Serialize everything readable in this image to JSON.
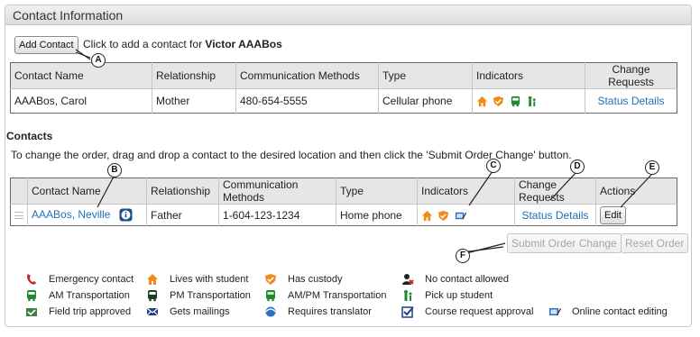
{
  "panel": {
    "title": "Contact Information"
  },
  "top": {
    "add_button": "Add Contact",
    "hint_prefix": "Click to add a contact for",
    "student_name": "Victor AAABos"
  },
  "primary_table": {
    "headers": [
      "Contact Name",
      "Relationship",
      "Communication Methods",
      "Type",
      "Indicators",
      "Change Requests"
    ],
    "row": {
      "name": "AAABos, Carol",
      "relationship": "Mother",
      "phone": "480-654-5555",
      "type": "Cellular phone",
      "indicators": [
        "lives-with-student-icon",
        "has-custody-icon",
        "am-pm-transportation-icon",
        "pick-up-student-icon"
      ],
      "change_link": "Status Details"
    }
  },
  "contacts": {
    "title": "Contacts",
    "instructions": "To change the order, drag and drop a contact to the desired location and then click the 'Submit Order Change' button.",
    "headers": [
      "Contact Name",
      "Relationship",
      "Communication Methods",
      "Type",
      "Indicators",
      "Change Requests",
      "Actions"
    ],
    "row": {
      "name": "AAABos, Neville",
      "relationship": "Father",
      "phone": "1-604-123-1234",
      "type": "Home phone",
      "indicators": [
        "lives-with-student-icon",
        "has-custody-icon",
        "online-contact-editing-icon"
      ],
      "change_link": "Status Details",
      "action": "Edit"
    },
    "submit_button": "Submit Order Change",
    "reset_button": "Reset Order"
  },
  "callouts": [
    "A",
    "B",
    "C",
    "D",
    "E",
    "F"
  ],
  "legend": [
    {
      "icon": "emergency-contact-icon",
      "label": "Emergency contact"
    },
    {
      "icon": "lives-with-student-icon",
      "label": "Lives with student"
    },
    {
      "icon": "has-custody-icon",
      "label": "Has custody"
    },
    {
      "icon": "no-contact-allowed-icon",
      "label": "No contact allowed"
    },
    {
      "icon": "am-transportation-icon",
      "label": "AM Transportation"
    },
    {
      "icon": "pm-transportation-icon",
      "label": "PM Transportation"
    },
    {
      "icon": "am-pm-transportation-icon",
      "label": "AM/PM Transportation"
    },
    {
      "icon": "pick-up-student-icon",
      "label": "Pick up student"
    },
    {
      "icon": "field-trip-approved-icon",
      "label": "Field trip approved"
    },
    {
      "icon": "gets-mailings-icon",
      "label": "Gets mailings"
    },
    {
      "icon": "requires-translator-icon",
      "label": "Requires translator"
    },
    {
      "icon": "course-request-approval-icon",
      "label": "Course request approval"
    },
    {
      "icon": "online-contact-editing-icon",
      "label": "Online contact editing"
    }
  ],
  "colors": {
    "orange": "#f08a1c",
    "green": "#1f8a2e",
    "red": "#c62828",
    "blue": "#1f6fb7"
  }
}
